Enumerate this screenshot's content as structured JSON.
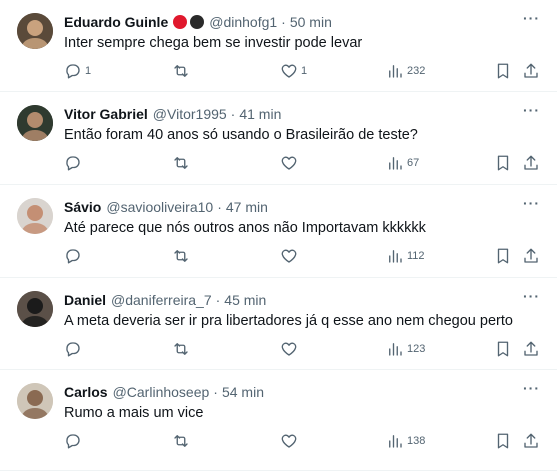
{
  "tweets": [
    {
      "name": "Eduardo Guinle",
      "badges": [
        "#e0182d",
        "#2a2a2a"
      ],
      "handle": "@dinhofg1",
      "separator": "·",
      "time": "50 min",
      "text": "Inter sempre chega bem se investir pode levar",
      "replies": "1",
      "retweets": "",
      "likes": "1",
      "views": "232",
      "avatar_colors": [
        "#5a4a3a",
        "#c9a27e"
      ]
    },
    {
      "name": "Vitor Gabriel",
      "badges": [],
      "handle": "@Vitor1995",
      "separator": "·",
      "time": "41 min",
      "text": "Então foram 40 anos só usando o Brasileirão de teste?",
      "replies": "",
      "retweets": "",
      "likes": "",
      "views": "67",
      "avatar_colors": [
        "#2f3a2f",
        "#b38b6d"
      ]
    },
    {
      "name": "Sávio",
      "badges": [],
      "handle": "@saviooliveira10",
      "separator": "·",
      "time": "47 min",
      "text": "Até parece que nós outros anos não Importavam kkkkkk",
      "replies": "",
      "retweets": "",
      "likes": "",
      "views": "112",
      "avatar_colors": [
        "#d9d4cf",
        "#c48f74"
      ]
    },
    {
      "name": "Daniel",
      "badges": [],
      "handle": "@daniferreira_7",
      "separator": "·",
      "time": "45 min",
      "text": "A meta deveria ser ir pra libertadores já q esse ano nem chegou perto",
      "replies": "",
      "retweets": "",
      "likes": "",
      "views": "123",
      "avatar_colors": [
        "#5b5048",
        "#1b1b1b"
      ]
    },
    {
      "name": "Carlos",
      "badges": [],
      "handle": "@Carlinhoseep",
      "separator": "·",
      "time": "54 min",
      "text": "Rumo a mais um vice",
      "replies": "",
      "retweets": "",
      "likes": "",
      "views": "138",
      "avatar_colors": [
        "#cfc6b8",
        "#8a6a52"
      ]
    }
  ],
  "icons": {
    "reply": "reply-icon",
    "retweet": "retweet-icon",
    "like": "heart-icon",
    "views": "views-icon",
    "bookmark": "bookmark-icon",
    "share": "share-icon",
    "more": "more-icon"
  },
  "colors": {
    "text": "#0f1419",
    "muted": "#536471",
    "divider": "#eff3f4"
  }
}
